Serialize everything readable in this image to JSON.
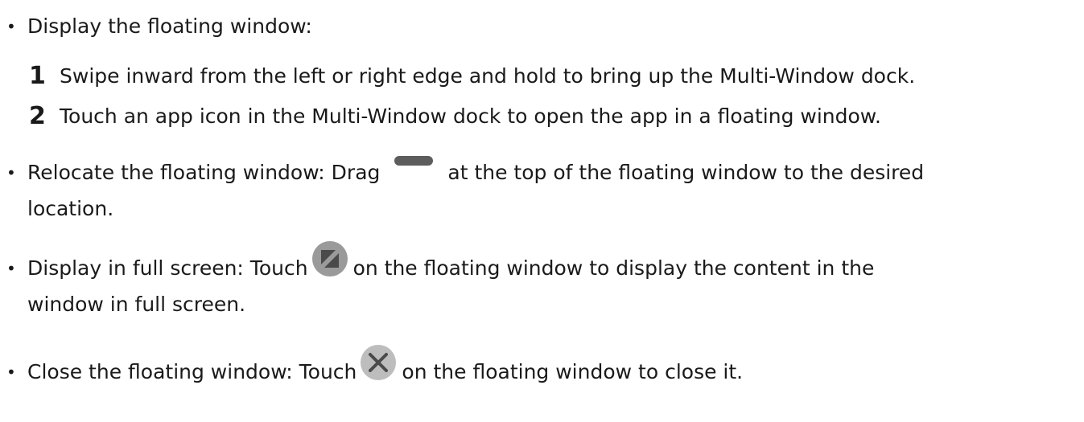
{
  "items": [
    {
      "text": "Display the floating window:"
    },
    {
      "text_before": "Relocate the floating window: Drag",
      "icon": "drag-handle-icon",
      "text_after": "at the top of the floating window to the desired",
      "text_line2": "location."
    },
    {
      "text_before": "Display in full screen: Touch",
      "icon": "fullscreen-icon",
      "text_after": "on the floating window to display the content in the",
      "text_line2": "window in full screen."
    },
    {
      "text_before": "Close the floating window: Touch",
      "icon": "close-icon",
      "text_after": "on the floating window to close it."
    }
  ],
  "steps": [
    {
      "number": "1",
      "text": "Swipe inward from the left or right edge and hold to bring up the Multi-Window dock."
    },
    {
      "number": "2",
      "text": "Touch an app icon in the Multi-Window dock to open the app in a floating window."
    }
  ],
  "colors": {
    "text": "#1a1a1a",
    "icon_gray": "#5d5d5d",
    "icon_circle": "#9a9a9a",
    "icon_dark": "#4a4a4a"
  }
}
